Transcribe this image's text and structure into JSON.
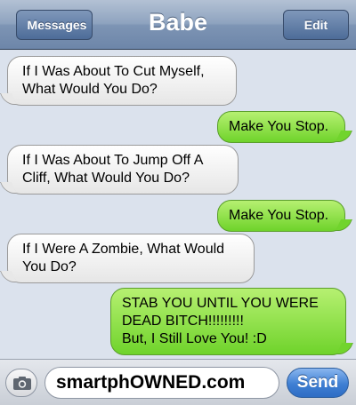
{
  "header": {
    "back_label": "Messages",
    "title": "Babe",
    "edit_label": "Edit"
  },
  "messages": [
    {
      "direction": "incoming",
      "lines": [
        "If I Was About To Cut Myself,",
        "What Would You Do?"
      ]
    },
    {
      "direction": "outgoing",
      "lines": [
        "Make You Stop."
      ]
    },
    {
      "direction": "incoming",
      "lines": [
        "If I Was About To Jump Off A",
        "Cliff, What Would You Do?"
      ]
    },
    {
      "direction": "outgoing",
      "lines": [
        "Make You Stop."
      ]
    },
    {
      "direction": "incoming",
      "lines": [
        "If I Were A Zombie, What Would",
        "You Do?"
      ]
    },
    {
      "direction": "outgoing",
      "lines": [
        "STAB YOU UNTIL YOU WERE",
        "DEAD BITCH!!!!!!!!!",
        "But, I Still Love You! :D"
      ]
    }
  ],
  "composer": {
    "camera_icon": "camera-icon",
    "text_value": "smartphOWNED.com",
    "send_label": "Send"
  },
  "colors": {
    "incoming_bubble": "#ececec",
    "outgoing_bubble": "#8ee24c",
    "background": "#dbe2ed",
    "navbar": "#8ea3bf",
    "send_button": "#3f7fd3"
  }
}
